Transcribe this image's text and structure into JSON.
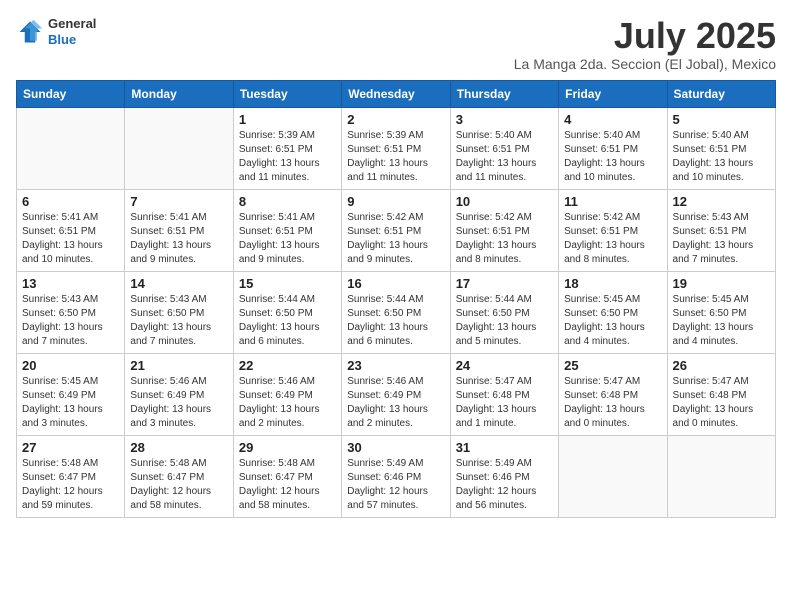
{
  "header": {
    "logo_line1": "General",
    "logo_line2": "Blue",
    "month_title": "July 2025",
    "location": "La Manga 2da. Seccion (El Jobal), Mexico"
  },
  "weekdays": [
    "Sunday",
    "Monday",
    "Tuesday",
    "Wednesday",
    "Thursday",
    "Friday",
    "Saturday"
  ],
  "weeks": [
    [
      {
        "day": "",
        "info": ""
      },
      {
        "day": "",
        "info": ""
      },
      {
        "day": "1",
        "info": "Sunrise: 5:39 AM\nSunset: 6:51 PM\nDaylight: 13 hours and 11 minutes."
      },
      {
        "day": "2",
        "info": "Sunrise: 5:39 AM\nSunset: 6:51 PM\nDaylight: 13 hours and 11 minutes."
      },
      {
        "day": "3",
        "info": "Sunrise: 5:40 AM\nSunset: 6:51 PM\nDaylight: 13 hours and 11 minutes."
      },
      {
        "day": "4",
        "info": "Sunrise: 5:40 AM\nSunset: 6:51 PM\nDaylight: 13 hours and 10 minutes."
      },
      {
        "day": "5",
        "info": "Sunrise: 5:40 AM\nSunset: 6:51 PM\nDaylight: 13 hours and 10 minutes."
      }
    ],
    [
      {
        "day": "6",
        "info": "Sunrise: 5:41 AM\nSunset: 6:51 PM\nDaylight: 13 hours and 10 minutes."
      },
      {
        "day": "7",
        "info": "Sunrise: 5:41 AM\nSunset: 6:51 PM\nDaylight: 13 hours and 9 minutes."
      },
      {
        "day": "8",
        "info": "Sunrise: 5:41 AM\nSunset: 6:51 PM\nDaylight: 13 hours and 9 minutes."
      },
      {
        "day": "9",
        "info": "Sunrise: 5:42 AM\nSunset: 6:51 PM\nDaylight: 13 hours and 9 minutes."
      },
      {
        "day": "10",
        "info": "Sunrise: 5:42 AM\nSunset: 6:51 PM\nDaylight: 13 hours and 8 minutes."
      },
      {
        "day": "11",
        "info": "Sunrise: 5:42 AM\nSunset: 6:51 PM\nDaylight: 13 hours and 8 minutes."
      },
      {
        "day": "12",
        "info": "Sunrise: 5:43 AM\nSunset: 6:51 PM\nDaylight: 13 hours and 7 minutes."
      }
    ],
    [
      {
        "day": "13",
        "info": "Sunrise: 5:43 AM\nSunset: 6:50 PM\nDaylight: 13 hours and 7 minutes."
      },
      {
        "day": "14",
        "info": "Sunrise: 5:43 AM\nSunset: 6:50 PM\nDaylight: 13 hours and 7 minutes."
      },
      {
        "day": "15",
        "info": "Sunrise: 5:44 AM\nSunset: 6:50 PM\nDaylight: 13 hours and 6 minutes."
      },
      {
        "day": "16",
        "info": "Sunrise: 5:44 AM\nSunset: 6:50 PM\nDaylight: 13 hours and 6 minutes."
      },
      {
        "day": "17",
        "info": "Sunrise: 5:44 AM\nSunset: 6:50 PM\nDaylight: 13 hours and 5 minutes."
      },
      {
        "day": "18",
        "info": "Sunrise: 5:45 AM\nSunset: 6:50 PM\nDaylight: 13 hours and 4 minutes."
      },
      {
        "day": "19",
        "info": "Sunrise: 5:45 AM\nSunset: 6:50 PM\nDaylight: 13 hours and 4 minutes."
      }
    ],
    [
      {
        "day": "20",
        "info": "Sunrise: 5:45 AM\nSunset: 6:49 PM\nDaylight: 13 hours and 3 minutes."
      },
      {
        "day": "21",
        "info": "Sunrise: 5:46 AM\nSunset: 6:49 PM\nDaylight: 13 hours and 3 minutes."
      },
      {
        "day": "22",
        "info": "Sunrise: 5:46 AM\nSunset: 6:49 PM\nDaylight: 13 hours and 2 minutes."
      },
      {
        "day": "23",
        "info": "Sunrise: 5:46 AM\nSunset: 6:49 PM\nDaylight: 13 hours and 2 minutes."
      },
      {
        "day": "24",
        "info": "Sunrise: 5:47 AM\nSunset: 6:48 PM\nDaylight: 13 hours and 1 minute."
      },
      {
        "day": "25",
        "info": "Sunrise: 5:47 AM\nSunset: 6:48 PM\nDaylight: 13 hours and 0 minutes."
      },
      {
        "day": "26",
        "info": "Sunrise: 5:47 AM\nSunset: 6:48 PM\nDaylight: 13 hours and 0 minutes."
      }
    ],
    [
      {
        "day": "27",
        "info": "Sunrise: 5:48 AM\nSunset: 6:47 PM\nDaylight: 12 hours and 59 minutes."
      },
      {
        "day": "28",
        "info": "Sunrise: 5:48 AM\nSunset: 6:47 PM\nDaylight: 12 hours and 58 minutes."
      },
      {
        "day": "29",
        "info": "Sunrise: 5:48 AM\nSunset: 6:47 PM\nDaylight: 12 hours and 58 minutes."
      },
      {
        "day": "30",
        "info": "Sunrise: 5:49 AM\nSunset: 6:46 PM\nDaylight: 12 hours and 57 minutes."
      },
      {
        "day": "31",
        "info": "Sunrise: 5:49 AM\nSunset: 6:46 PM\nDaylight: 12 hours and 56 minutes."
      },
      {
        "day": "",
        "info": ""
      },
      {
        "day": "",
        "info": ""
      }
    ]
  ]
}
